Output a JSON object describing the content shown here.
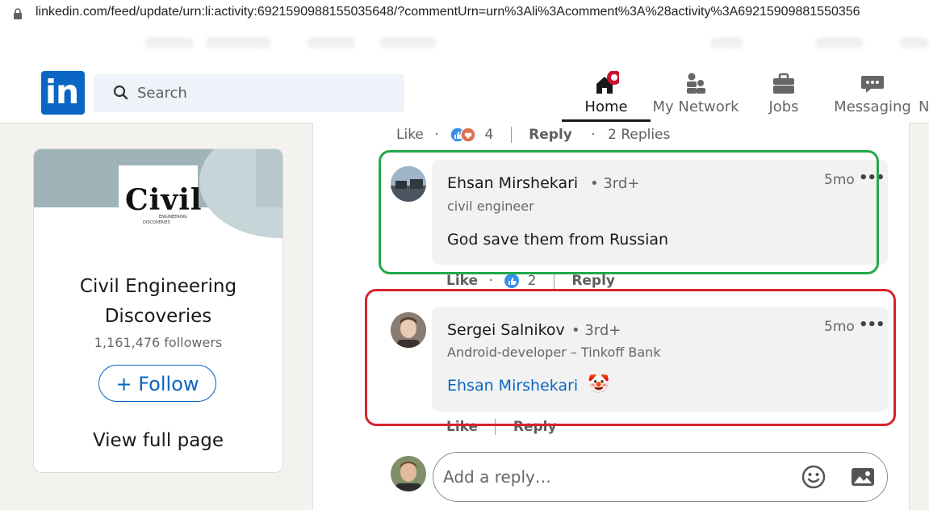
{
  "browser": {
    "url": "linkedin.com/feed/update/urn:li:activity:6921590988155035648/?commentUrn=urn%3Ali%3Acomment%3A%28activity%3A69215909881550356"
  },
  "nav": {
    "search_placeholder": "Search",
    "items": [
      {
        "label": "Home",
        "icon": "home-icon",
        "badge": true
      },
      {
        "label": "My Network",
        "icon": "network-icon"
      },
      {
        "label": "Jobs",
        "icon": "briefcase-icon"
      },
      {
        "label": "Messaging",
        "icon": "messaging-icon"
      },
      {
        "label": "N",
        "icon": "notifications-icon"
      }
    ]
  },
  "company": {
    "logo_text": "Civil",
    "logo_sub1": "ENGINEERING",
    "logo_sub2": "DISCOVERIES",
    "name": "Civil Engineering Discoveries",
    "followers": "1,161,476 followers",
    "follow_label": "Follow",
    "view_full": "View full page"
  },
  "top_actions": {
    "like": "Like",
    "reaction_count": "4",
    "reply": "Reply",
    "replies": "2 Replies"
  },
  "comments": [
    {
      "author": "Ehsan Mirshekari",
      "degree": "• 3rd+",
      "headline": "civil engineer",
      "text": "God save them from Russian",
      "time": "5mo",
      "like": "Like",
      "reaction_count": "2",
      "reply": "Reply"
    },
    {
      "author": "Sergei Salnikov",
      "degree": "• 3rd+",
      "headline": "Android-developer – Tinkoff Bank",
      "mention": "Ehsan Mirshekari",
      "emoji": "🤡",
      "time": "5mo",
      "like": "Like",
      "reply": "Reply"
    }
  ],
  "reply_box": {
    "placeholder": "Add a reply…"
  },
  "colors": {
    "brand": "#0a66c2",
    "highlight_green": "#22a94a",
    "highlight_red": "#d8232a"
  }
}
